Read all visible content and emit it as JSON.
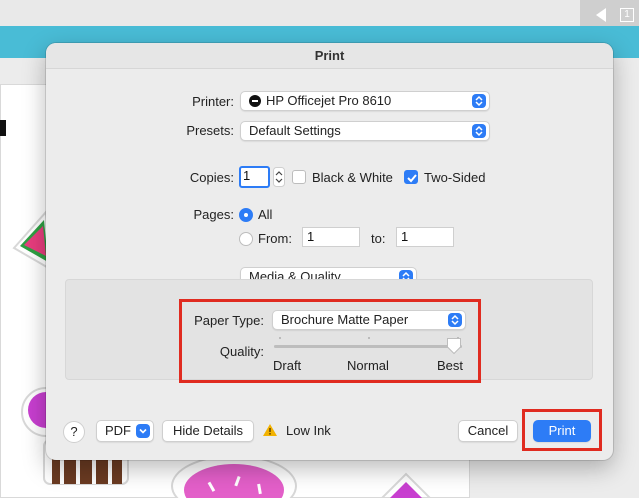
{
  "dialog": {
    "title": "Print"
  },
  "printer": {
    "label": "Printer:",
    "value": "HP Officejet Pro 8610"
  },
  "presets": {
    "label": "Presets:",
    "value": "Default Settings"
  },
  "copies": {
    "label": "Copies:",
    "value": "1",
    "black_white_label": "Black & White",
    "black_white_checked": false,
    "two_sided_label": "Two-Sided",
    "two_sided_checked": true
  },
  "pages": {
    "label": "Pages:",
    "all_label": "All",
    "from_label": "From:",
    "from_value": "1",
    "to_label": "to:",
    "to_value": "1",
    "selected": "All"
  },
  "section": {
    "value": "Media & Quality"
  },
  "paper_type": {
    "label": "Paper Type:",
    "value": "Brochure Matte Paper"
  },
  "quality": {
    "label": "Quality:",
    "ticks": [
      "Draft",
      "Normal",
      "Best"
    ],
    "selected": "Best"
  },
  "footer": {
    "help_label": "?",
    "pdf_label": "PDF",
    "hide_details_label": "Hide Details",
    "low_ink_label": "Low Ink",
    "cancel_label": "Cancel",
    "print_label": "Print"
  },
  "colors": {
    "accent": "#2d7cf6",
    "highlight": "#e02b20",
    "teal_bar": "#49bcd6",
    "warning": "#f2b200"
  },
  "background_app": {
    "scroll_label": "1"
  }
}
